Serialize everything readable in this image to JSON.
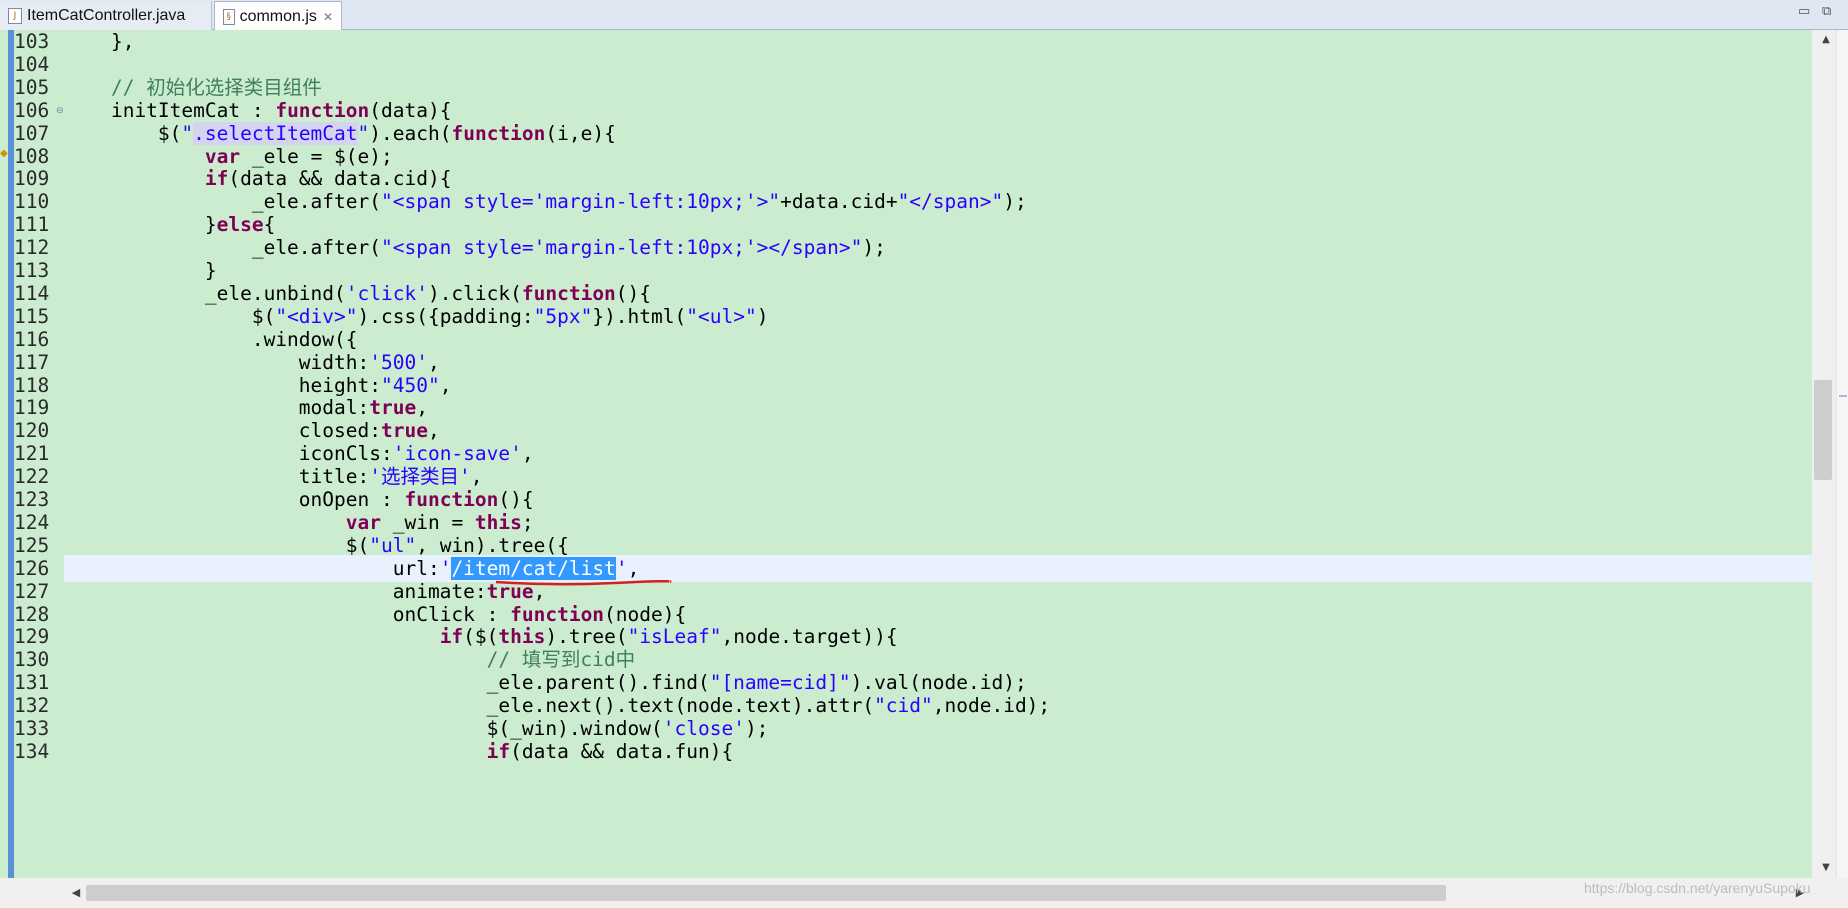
{
  "tabs": [
    {
      "label": "ItemCatController.java",
      "icon": "java-file-icon",
      "active": false
    },
    {
      "label": "common.js",
      "icon": "js-file-icon",
      "active": true,
      "close": "✕"
    }
  ],
  "window_controls": {
    "minimize": "▭",
    "maximize": "⧉"
  },
  "editor": {
    "current_line": 126,
    "lines": [
      {
        "n": "103",
        "code": "    },"
      },
      {
        "n": "104",
        "code": ""
      },
      {
        "n": "105",
        "code": "    // 初始化选择类目组件"
      },
      {
        "n": "106",
        "code": "    initItemCat : function(data){",
        "fold": true
      },
      {
        "n": "107",
        "code": "        $(\".selectItemCat\").each(function(i,e){"
      },
      {
        "n": "108",
        "code": "            var _ele = $(e);"
      },
      {
        "n": "109",
        "code": "            if(data && data.cid){"
      },
      {
        "n": "110",
        "code": "                _ele.after(\"<span style='margin-left:10px;'>\"+data.cid+\"</span>\");"
      },
      {
        "n": "111",
        "code": "            }else{"
      },
      {
        "n": "112",
        "code": "                _ele.after(\"<span style='margin-left:10px;'></span>\");"
      },
      {
        "n": "113",
        "code": "            }"
      },
      {
        "n": "114",
        "code": "            _ele.unbind('click').click(function(){"
      },
      {
        "n": "115",
        "code": "                $(\"<div>\").css({padding:\"5px\"}).html(\"<ul>\")"
      },
      {
        "n": "116",
        "code": "                .window({"
      },
      {
        "n": "117",
        "code": "                    width:'500',"
      },
      {
        "n": "118",
        "code": "                    height:\"450\","
      },
      {
        "n": "119",
        "code": "                    modal:true,"
      },
      {
        "n": "120",
        "code": "                    closed:true,"
      },
      {
        "n": "121",
        "code": "                    iconCls:'icon-save',"
      },
      {
        "n": "122",
        "code": "                    title:'选择类目',"
      },
      {
        "n": "123",
        "code": "                    onOpen : function(){"
      },
      {
        "n": "124",
        "code": "                        var _win = this;"
      },
      {
        "n": "125",
        "code": "                        $(\"ul\",_win).tree({"
      },
      {
        "n": "126",
        "code": "                            url:'/item/cat/list',"
      },
      {
        "n": "127",
        "code": "                            animate:true,"
      },
      {
        "n": "128",
        "code": "                            onClick : function(node){"
      },
      {
        "n": "129",
        "code": "                                if($(this).tree(\"isLeaf\",node.target)){"
      },
      {
        "n": "130",
        "code": "                                    // 填写到cid中"
      },
      {
        "n": "131",
        "code": "                                    _ele.parent().find(\"[name=cid]\").val(node.id);"
      },
      {
        "n": "132",
        "code": "                                    _ele.next().text(node.text).attr(\"cid\",node.id);"
      },
      {
        "n": "133",
        "code": "                                    $(_win).window('close');"
      },
      {
        "n": "134",
        "code": "                                    if(data && data.fun){"
      }
    ],
    "selection_text": "/item/cat/list",
    "occurrence_text": ".selectItemCat"
  },
  "watermark": "https://blog.csdn.net/yarenyuSupoku",
  "colors": {
    "background": "#cbeccf",
    "keyword": "#7f0055",
    "string": "#2a00ff",
    "comment": "#3f7f5f",
    "selection": "#3399ff",
    "current_line": "#e8f1fd",
    "annotation_underline": "#d62020"
  }
}
